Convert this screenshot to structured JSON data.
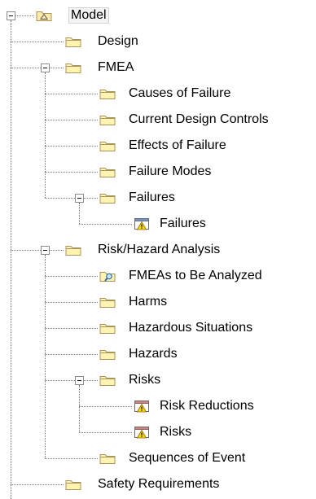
{
  "tree": {
    "nodes": [
      {
        "id": "model",
        "label": "Model",
        "depth": 0,
        "icon": "package-icon",
        "expander": "minus",
        "selected": true
      },
      {
        "id": "design",
        "label": "Design",
        "depth": 1,
        "icon": "folder-icon"
      },
      {
        "id": "fmea",
        "label": "FMEA",
        "depth": 1,
        "icon": "folder-icon",
        "expander": "minus"
      },
      {
        "id": "causes-of-failure",
        "label": "Causes of Failure",
        "depth": 2,
        "icon": "folder-icon"
      },
      {
        "id": "current-design-controls",
        "label": "Current Design Controls",
        "depth": 2,
        "icon": "folder-icon"
      },
      {
        "id": "effects-of-failure",
        "label": "Effects of Failure",
        "depth": 2,
        "icon": "folder-icon"
      },
      {
        "id": "failure-modes",
        "label": "Failure Modes",
        "depth": 2,
        "icon": "folder-icon"
      },
      {
        "id": "failures-folder",
        "label": "Failures",
        "depth": 2,
        "icon": "folder-icon",
        "expander": "minus"
      },
      {
        "id": "failures-table",
        "label": "Failures",
        "depth": 3,
        "icon": "warning-table-icon-blue"
      },
      {
        "id": "risk-hazard-analysis",
        "label": "Risk/Hazard Analysis",
        "depth": 1,
        "icon": "folder-icon",
        "expander": "minus"
      },
      {
        "id": "fmeas-to-be-analyzed",
        "label": "FMEAs to Be Analyzed",
        "depth": 2,
        "icon": "search-query-icon"
      },
      {
        "id": "harms",
        "label": "Harms",
        "depth": 2,
        "icon": "folder-icon"
      },
      {
        "id": "hazardous-situations",
        "label": "Hazardous Situations",
        "depth": 2,
        "icon": "folder-icon"
      },
      {
        "id": "hazards",
        "label": "Hazards",
        "depth": 2,
        "icon": "folder-icon"
      },
      {
        "id": "risks-folder",
        "label": "Risks",
        "depth": 2,
        "icon": "folder-icon",
        "expander": "minus"
      },
      {
        "id": "risk-reductions",
        "label": "Risk Reductions",
        "depth": 3,
        "icon": "warning-table-icon-red"
      },
      {
        "id": "risks-table",
        "label": "Risks",
        "depth": 3,
        "icon": "warning-table-icon-red"
      },
      {
        "id": "sequences-of-event",
        "label": "Sequences of Event",
        "depth": 2,
        "icon": "folder-icon"
      },
      {
        "id": "safety-requirements",
        "label": "Safety Requirements",
        "depth": 1,
        "icon": "folder-icon"
      }
    ]
  },
  "colors": {
    "folder_fill": "#fff3b0",
    "folder_stroke": "#a89460",
    "package_fill": "#ffe9a8",
    "warning_yellow": "#f7d600",
    "table_header_blue": "#6f8fd6",
    "table_header_red": "#e27a7a",
    "selection_bg": "#f3f3f3",
    "tree_line": "#6f6f6f"
  }
}
